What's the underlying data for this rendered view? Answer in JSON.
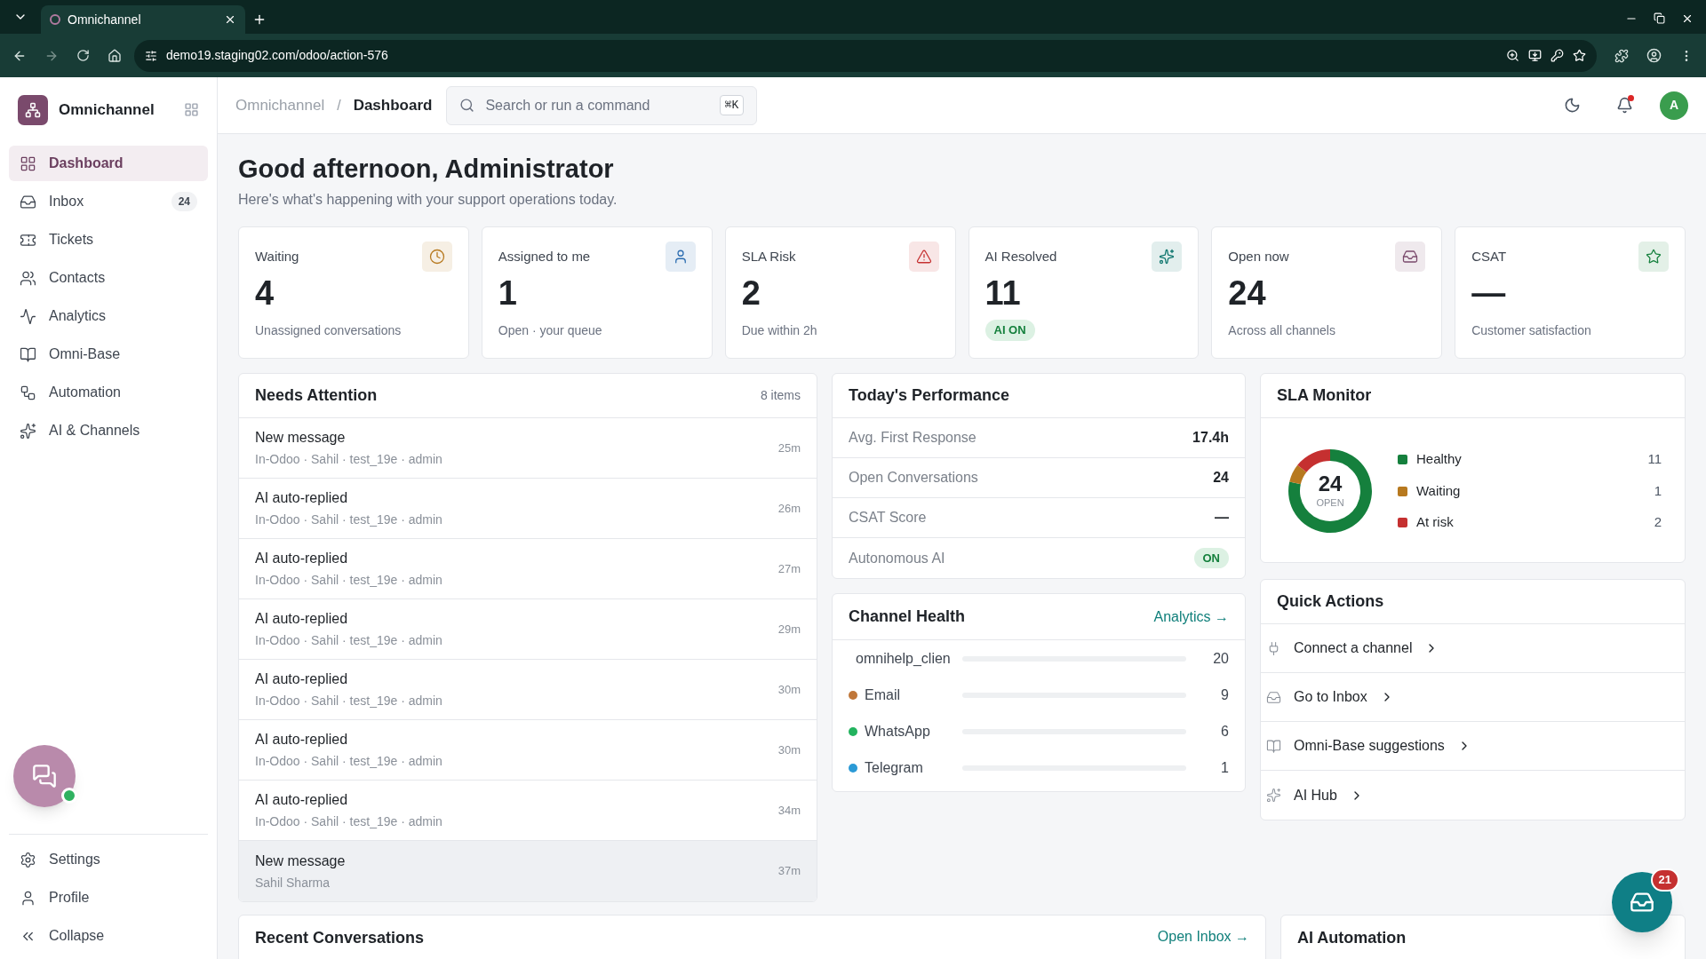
{
  "browser": {
    "tab_title": "Omnichannel",
    "url": "demo19.staging02.com/odoo/action-576"
  },
  "app": {
    "name": "Omnichannel"
  },
  "sidebar": {
    "items": [
      {
        "label": "Dashboard",
        "selected": true
      },
      {
        "label": "Inbox",
        "selected": false,
        "badge": "24"
      },
      {
        "label": "Tickets",
        "selected": false
      },
      {
        "label": "Contacts",
        "selected": false
      },
      {
        "label": "Analytics",
        "selected": false
      },
      {
        "label": "Omni-Base",
        "selected": false
      },
      {
        "label": "Automation",
        "selected": false
      },
      {
        "label": "AI & Channels",
        "selected": false
      }
    ],
    "footer_items": [
      {
        "label": "Settings"
      },
      {
        "label": "Profile"
      },
      {
        "label": "Collapse"
      }
    ],
    "chat_online": true
  },
  "header": {
    "breadcrumb": [
      "Omnichannel",
      "Dashboard"
    ],
    "breadcrumb_separator": "/",
    "search_placeholder": "Search or run a command",
    "shortcut": "⌘K",
    "avatar": "A",
    "notifications_unread": true
  },
  "greeting": {
    "title": "Good afternoon, Administrator",
    "subtitle": "Here's what's happening with your support operations today."
  },
  "stats": [
    {
      "label": "Waiting",
      "value": "4",
      "caption": "Unassigned conversations",
      "color": "#b7791f"
    },
    {
      "label": "Assigned to me",
      "value": "1",
      "caption": "Open · your queue",
      "color": "#2b6cb0"
    },
    {
      "label": "SLA Risk",
      "value": "2",
      "caption": "Due within 2h",
      "color": "#c53030"
    },
    {
      "label": "AI Resolved",
      "value": "11",
      "badge": "AI ON",
      "color": "#0f766e"
    },
    {
      "label": "Open now",
      "value": "24",
      "caption": "Across all channels",
      "color": "#7a4a6c"
    },
    {
      "label": "CSAT",
      "value": "—",
      "caption": "Customer satisfaction",
      "color": "#15803d"
    }
  ],
  "needs_attention": {
    "title": "Needs Attention",
    "count": "8 items",
    "items": [
      {
        "title": "New message",
        "meta": "In-Odoo · Sahil · test_19e · admin",
        "time": "25m",
        "selected": false
      },
      {
        "title": "AI auto-replied",
        "meta": "In-Odoo · Sahil · test_19e · admin",
        "time": "26m",
        "selected": false
      },
      {
        "title": "AI auto-replied",
        "meta": "In-Odoo · Sahil · test_19e · admin",
        "time": "27m",
        "selected": false
      },
      {
        "title": "AI auto-replied",
        "meta": "In-Odoo · Sahil · test_19e · admin",
        "time": "29m",
        "selected": false
      },
      {
        "title": "AI auto-replied",
        "meta": "In-Odoo · Sahil · test_19e · admin",
        "time": "30m",
        "selected": false
      },
      {
        "title": "AI auto-replied",
        "meta": "In-Odoo · Sahil · test_19e · admin",
        "time": "30m",
        "selected": false
      },
      {
        "title": "AI auto-replied",
        "meta": "In-Odoo · Sahil · test_19e · admin",
        "time": "34m",
        "selected": false
      },
      {
        "title": "New message",
        "meta": "Sahil Sharma",
        "time": "37m",
        "selected": true
      }
    ]
  },
  "performance": {
    "title": "Today's Performance",
    "rows": [
      {
        "label": "Avg. First Response",
        "value": "17.4h",
        "kind": "text"
      },
      {
        "label": "Open Conversations",
        "value": "24",
        "kind": "text"
      },
      {
        "label": "CSAT Score",
        "value": "—",
        "kind": "text"
      },
      {
        "label": "Autonomous AI",
        "value": "ON",
        "kind": "badge"
      }
    ]
  },
  "channel_health": {
    "title": "Channel Health",
    "link": "Analytics →",
    "channels": [
      {
        "name": "omnihelp_clien",
        "count": "20"
      },
      {
        "name": "Email",
        "count": "9",
        "color": "#c0773a"
      },
      {
        "name": "WhatsApp",
        "count": "6",
        "color": "#22b35e"
      },
      {
        "name": "Telegram",
        "count": "1",
        "color": "#2b9ad6"
      }
    ]
  },
  "sla_monitor": {
    "title": "SLA Monitor",
    "center_value": "24",
    "center_label": "OPEN",
    "legend": [
      {
        "count": "11",
        "color": "#15803d"
      },
      {
        "count": "1",
        "color": "#b7791f"
      },
      {
        "count": "2",
        "color": "#c53030"
      }
    ],
    "chart_data": {
      "type": "donut",
      "categories": [
        "Healthy",
        "Waiting",
        "At risk"
      ],
      "values": [
        78.6,
        7.1,
        14.3
      ]
    }
  },
  "quick_actions": {
    "title": "Quick Actions",
    "items": [
      {
        "label": "Connect a channel"
      },
      {
        "label": "Go to Inbox"
      },
      {
        "label": "Omni-Base suggestions"
      },
      {
        "label": "AI Hub"
      }
    ]
  },
  "recent_conversations": {
    "title": "Recent Conversations",
    "link": "Open Inbox →"
  },
  "ai_automation": {
    "title": "AI Automation"
  },
  "inbox_fab": {
    "badge": "21"
  }
}
